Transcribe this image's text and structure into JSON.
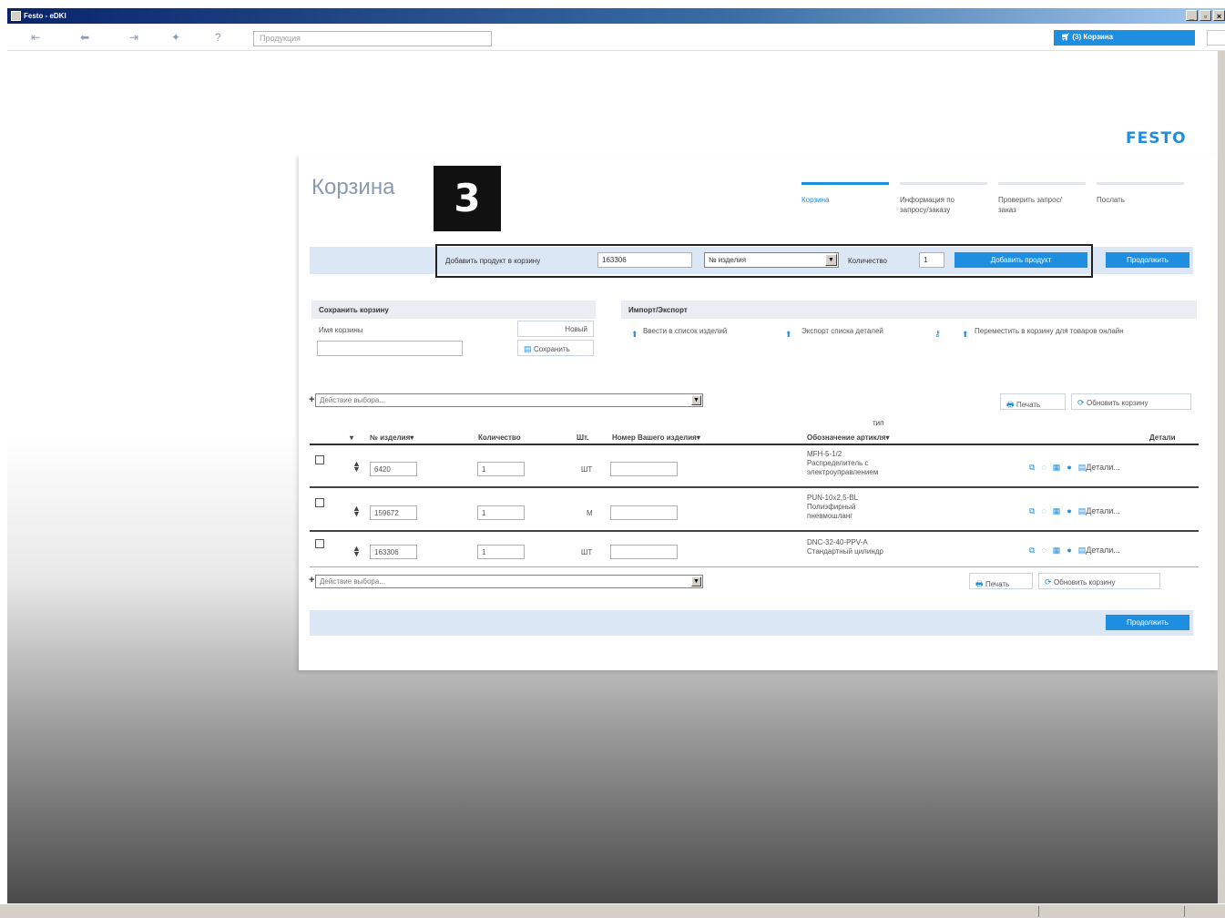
{
  "window": {
    "title": "Festo - eDKI",
    "min": "_",
    "max": "▫",
    "close": "×"
  },
  "toolbar": {
    "search_placeholder": "Продукция",
    "cart_button": "(3) Корзина",
    "cart_icon": "cart-icon"
  },
  "logo": {
    "text": "FESTO"
  },
  "cart": {
    "title": "Корзина",
    "step_badge": "3",
    "steps": [
      {
        "label": "Корзина",
        "active": true
      },
      {
        "label": "Информация по запросу/заказу",
        "active": false
      },
      {
        "label": "Проверить запрос/ заказ",
        "active": false
      },
      {
        "label": "Послать",
        "active": false
      }
    ],
    "add": {
      "label": "Добавить продукт в корзину",
      "product_value": "163306",
      "type_value": "№ изделия",
      "qty_label": "Количество",
      "qty_value": "1",
      "add_button": "Добавить продукт",
      "continue_button": "Продолжить"
    },
    "save": {
      "title": "Сохранить корзину",
      "name_label": "Имя корзины",
      "new_button": "Новый",
      "save_button": "Сохранить"
    },
    "io": {
      "title": "Импорт/Экспорт",
      "import_label": "Ввести в список изделий",
      "export_label": "Экспорт списка деталей",
      "move_label": "Переместить в корзину для товаров онлайн"
    },
    "actions": {
      "select_placeholder": "Действие выбора...",
      "print": "Печать",
      "refresh": "Обновить корзину"
    },
    "columns": {
      "part_no": "№ изделия",
      "quantity": "Количество",
      "unit": "Шт.",
      "your_part": "Номер Вашего изделия",
      "type_top": "тип",
      "designation": "Обозначение артикля",
      "details": "Детали"
    },
    "rows": [
      {
        "part_no": "6420",
        "qty": "1",
        "unit": "ШТ",
        "desc": [
          "MFH-5-1/2",
          "Распределитель с",
          "электроуправлением"
        ],
        "details": "Детали..."
      },
      {
        "part_no": "159672",
        "qty": "1",
        "unit": "M",
        "desc": [
          "PUN-10x2,5-BL",
          "Полиэфирный",
          "пневмошланг"
        ],
        "details": "Детали..."
      },
      {
        "part_no": "163306",
        "qty": "1",
        "unit": "ШТ",
        "desc": [
          "DNC-32-40-PPV-A",
          "Стандартный цилиндр"
        ],
        "details": "Детали..."
      }
    ],
    "bottom_continue": "Продолжить"
  },
  "colors": {
    "accent": "#1e8fe0",
    "titlebar": "#0a246a",
    "bar_bg": "#dbe7f4"
  }
}
